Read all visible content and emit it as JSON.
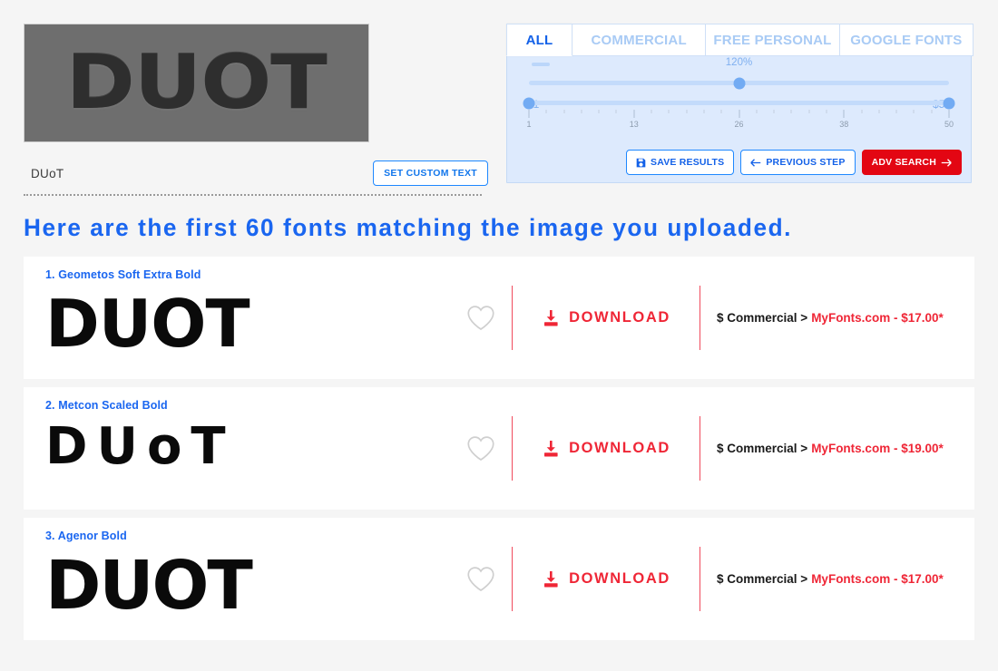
{
  "preview": {
    "image_text": "DUOT",
    "custom_text_value": "DUoT",
    "set_custom_text_label": "SET CUSTOM TEXT"
  },
  "filters": {
    "tabs": [
      {
        "label": "ALL",
        "active": true
      },
      {
        "label": "COMMERCIAL",
        "active": false
      },
      {
        "label": "FREE PERSONAL",
        "active": false
      },
      {
        "label": "GOOGLE FONTS",
        "active": false
      }
    ],
    "size_slider": {
      "value_label": "120%",
      "value_pct": 50
    },
    "price_slider": {
      "min_label": "$1",
      "max_label": "$50",
      "min_pct": 0,
      "max_pct": 100,
      "tick_labels": [
        "1",
        "13",
        "26",
        "38",
        "50"
      ],
      "tick_positions": [
        0,
        25,
        50,
        75,
        100
      ]
    },
    "actions": [
      {
        "label": "SAVE RESULTS",
        "icon": "save-floppy-icon",
        "style": "outline",
        "icon_side": "left"
      },
      {
        "label": "PREVIOUS STEP",
        "icon": "arrow-left-icon",
        "style": "outline",
        "icon_side": "left"
      },
      {
        "label": "ADV SEARCH",
        "icon": "arrow-right-icon",
        "style": "danger",
        "icon_side": "right"
      }
    ]
  },
  "headline": "Here are the first 60 fonts matching the image you uploaded.",
  "results": [
    {
      "index_label": "1. Geometos Soft Extra Bold",
      "sample_text": "DUOT",
      "sample_size": "72px",
      "sample_spacing": "-1px",
      "download_label": "DOWNLOAD",
      "license_label": "$ Commercial >",
      "vendor_price": "MyFonts.com - $17.00*"
    },
    {
      "index_label": "2. Metcon Scaled Bold",
      "sample_text": "DUoT",
      "sample_size": "56px",
      "sample_spacing": "10px",
      "download_label": "DOWNLOAD",
      "license_label": "$ Commercial >",
      "vendor_price": "MyFonts.com - $19.00*"
    },
    {
      "index_label": "3. Agenor Bold",
      "sample_text": "DUOT",
      "sample_size": "74px",
      "sample_spacing": "-2px",
      "download_label": "DOWNLOAD",
      "license_label": "$ Commercial >",
      "vendor_price": "MyFonts.com - $17.00*"
    }
  ]
}
